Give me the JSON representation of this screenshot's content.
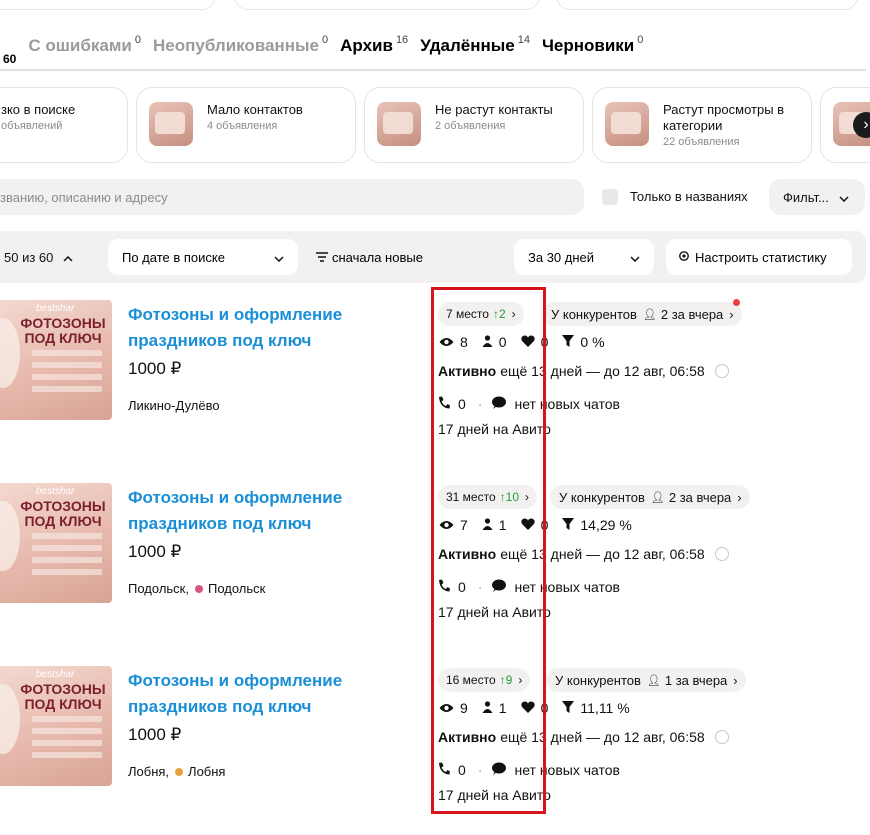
{
  "tabs": [
    {
      "label": "",
      "count": "60"
    },
    {
      "label": "С ошибками",
      "count": "0"
    },
    {
      "label": "Неопубликованные",
      "count": "0"
    },
    {
      "label": "Архив",
      "count": "16"
    },
    {
      "label": "Удалённые",
      "count": "14"
    },
    {
      "label": "Черновики",
      "count": "0"
    }
  ],
  "cards": [
    {
      "title": "зко в поиске",
      "subtitle": "объявлений"
    },
    {
      "title": "Мало контактов",
      "subtitle": "4 объявления"
    },
    {
      "title": "Не растут контакты",
      "subtitle": "2 объявления"
    },
    {
      "title": "Растут просмотры в категории",
      "subtitle": "22 объявления"
    },
    {
      "title": "",
      "subtitle": ""
    }
  ],
  "search": {
    "placeholder": "званию, описанию и адресу"
  },
  "only_titles_label": "Только в названиях",
  "filter_label": "Фильт...",
  "toolbar": {
    "count_label": "50 из 60",
    "sort_label": "По дате в поиске",
    "order_label": "сначала новые",
    "period_label": "За 30 дней",
    "stats_label": "Настроить статистику"
  },
  "listings": [
    {
      "title": "Фотозоны и оформление праздников под ключ",
      "price": "1000 ₽",
      "location": "Ликино-Дулёво",
      "metro": "",
      "metro_color": "",
      "rank": "7 место",
      "rank_delta": "2",
      "competitors": "У конкурентов",
      "competitors_count": "2 за вчера",
      "views": "8",
      "contacts": "0",
      "favorites": "0",
      "conversion": "0 %",
      "status_bold": "Активно",
      "status_text": "ещё 13 дней — до 12 авг, 06:58",
      "calls": "0",
      "chats": "нет новых чатов",
      "days_on": "17 дней на Авито",
      "pic_brand": "bestshar",
      "pic_title": "ФОТОЗОНЫ ПОД КЛЮЧ"
    },
    {
      "title": "Фотозоны и оформление праздников под ключ",
      "price": "1000 ₽",
      "location": "Подольск,",
      "metro": "Подольск",
      "metro_color": "#d9537a",
      "rank": "31 место",
      "rank_delta": "10",
      "competitors": "У конкурентов",
      "competitors_count": "2 за вчера",
      "views": "7",
      "contacts": "1",
      "favorites": "0",
      "conversion": "14,29 %",
      "status_bold": "Активно",
      "status_text": "ещё 13 дней — до 12 авг, 06:58",
      "calls": "0",
      "chats": "нет новых чатов",
      "days_on": "17 дней на Авито",
      "pic_brand": "bestshar",
      "pic_title": "ФОТОЗОНЫ ПОД КЛЮЧ"
    },
    {
      "title": "Фотозоны и оформление праздников под ключ",
      "price": "1000 ₽",
      "location": "Лобня,",
      "metro": "Лобня",
      "metro_color": "#e6a13c",
      "rank": "16 место",
      "rank_delta": "9",
      "competitors": "У конкурентов",
      "competitors_count": "1 за вчера",
      "views": "9",
      "contacts": "1",
      "favorites": "0",
      "conversion": "11,11 %",
      "status_bold": "Активно",
      "status_text": "ещё 13 дней — до 12 авг, 06:58",
      "calls": "0",
      "chats": "нет новых чатов",
      "days_on": "17 дней на Авито",
      "pic_brand": "bestshar",
      "pic_title": "ФОТОЗОНЫ ПОД КЛЮЧ"
    }
  ],
  "colors": {
    "link": "#1a8fd6",
    "up": "#1f9b3e",
    "highlight": "#d7141b",
    "notification": "#f03d3d"
  },
  "icons": {
    "views": "eye-icon",
    "contacts": "person-icon",
    "favorites": "heart-icon",
    "conversion": "funnel-icon",
    "calls": "phone-icon",
    "chats": "chat-icon"
  }
}
